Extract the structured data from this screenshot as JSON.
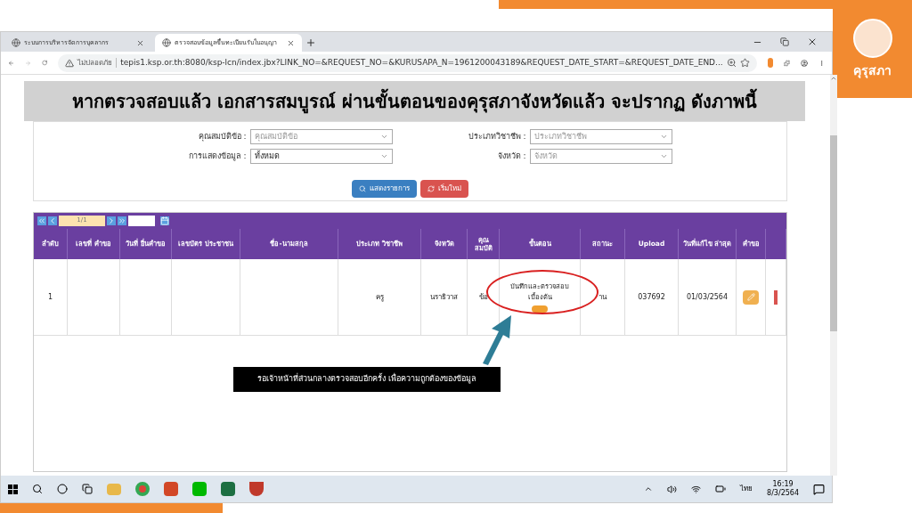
{
  "logo": {
    "text": "คุรุสภา"
  },
  "browser": {
    "tabs": [
      {
        "title": "ระบบการบริหารจัดการบุคลากร",
        "selected": false
      },
      {
        "title": "ตรวจสอบข้อมูลขึ้นทะเบียนรับใบอนุญา",
        "selected": true
      }
    ],
    "security_label": "ไม่ปลอดภัย",
    "url": "tepis1.ksp.or.th:8080/ksp-lcn/index.jbx?LINK_NO=&REQUEST_NO=&KURUSAPA_N=1961200043189&REQUEST_DATE_START=&REQUEST_DATE_END..."
  },
  "banner": "หากตรวจสอบแล้ว เอกสารสมบูรณ์ ผ่านขั้นตอนของคุรุสภาจังหวัดแล้ว จะปรากฏ ดังภาพนี้",
  "filters": [
    {
      "label": "คุณสมบัติข้อ :",
      "placeholder": "คุณสมบัติข้อ"
    },
    {
      "label": "ประเภทวิชาชีพ :",
      "placeholder": "ประเภทวิชาชีพ"
    },
    {
      "label": "การแสดงข้อมูล :",
      "value": "ทั้งหมด"
    },
    {
      "label": "จังหวัด :",
      "placeholder": "จังหวัด"
    }
  ],
  "buttons": [
    {
      "label": "แสดงรายการ",
      "kind": "search"
    },
    {
      "label": "เริ่มใหม่",
      "kind": "reset"
    }
  ],
  "pager": {
    "page": "1/1"
  },
  "table": {
    "columns": [
      "ลำดับ",
      "เลขที่ คำขอ",
      "วันที่ ยื่นคำขอ",
      "เลขบัตร ประชาชน",
      "ชื่อ-นามสกุล",
      "ประเภท วิชาชีพ",
      "จังหวัด",
      "คุณ สมบัติ",
      "ขั้นตอน",
      "สถานะ",
      "Upload",
      "วันที่แก้ไข ล่าสุด",
      "คำขอ",
      ""
    ],
    "rows": [
      {
        "cells": [
          "1",
          "",
          "",
          "",
          "",
          "ครู",
          "นราธิวาส",
          "ข้อ",
          "บันทึกและตรวจสอบเบื้องต้น",
          "าน",
          "037692",
          "01/03/2564"
        ]
      }
    ]
  },
  "callout": "รอเจ้าหน้าที่ส่วนกลางตรวจสอบอีกครั้ง เพื่อความถูกต้องของข้อมูล",
  "taskbar": {
    "language": "ไทย",
    "time": "16:19",
    "date": "8/3/2564"
  }
}
